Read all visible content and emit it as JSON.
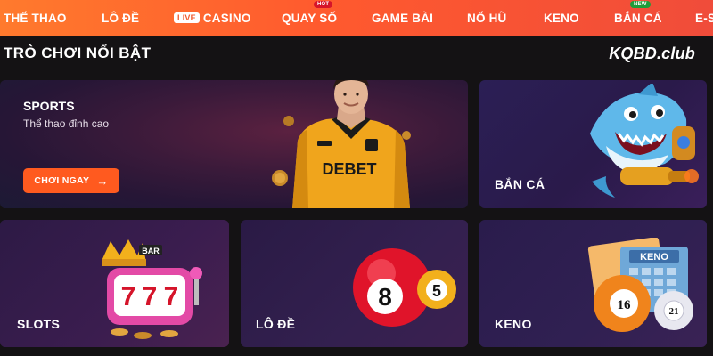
{
  "nav": {
    "items": [
      {
        "label": "THỂ THAO"
      },
      {
        "label": "LÔ ĐỀ"
      },
      {
        "label": "CASINO",
        "badge": "LIVE"
      },
      {
        "label": "QUAY SỐ",
        "tag": "HOT"
      },
      {
        "label": "GAME BÀI"
      },
      {
        "label": "NỔ HŨ"
      },
      {
        "label": "KENO"
      },
      {
        "label": "BẮN CÁ",
        "tag": "NEW"
      },
      {
        "label": "E-S"
      }
    ]
  },
  "section": {
    "title": "TRÒ CHƠI NỔI BẬT",
    "logo": "KQBD.club"
  },
  "cards": {
    "sports": {
      "title": "SPORTS",
      "subtitle": "Thể thao đỉnh cao",
      "cta": "CHƠI NGAY",
      "jersey_brand": "DEBET"
    },
    "fishing": {
      "label": "BẮN CÁ"
    },
    "slots": {
      "label": "SLOTS",
      "reel_symbol": "7",
      "bar_text": "BAR"
    },
    "lode": {
      "label": "LÔ ĐỀ",
      "ball_big": "8",
      "ball_small": "5"
    },
    "keno": {
      "label": "KENO",
      "ticket_title": "KENO",
      "ball_left": "16",
      "ball_right": "21"
    }
  },
  "colors": {
    "nav_gradient_start": "#ff7a2d",
    "nav_gradient_end": "#f04c3a",
    "cta": "#ff5a1f",
    "background": "#141214"
  }
}
